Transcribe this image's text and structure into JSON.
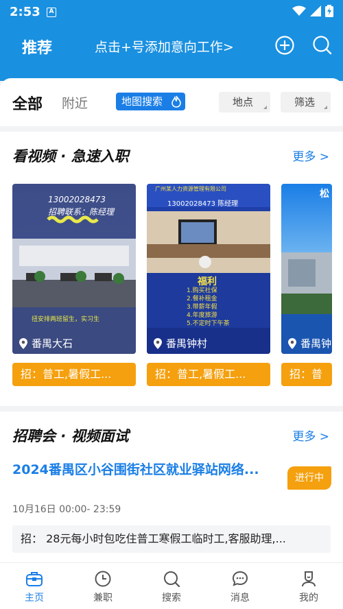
{
  "status": {
    "time": "2:53",
    "a_icon": "A"
  },
  "header": {
    "tab_label": "推荐",
    "add_hint": "点击+号添加意向工作>",
    "plus_icon": "plus-circle-icon",
    "search_icon": "search-icon"
  },
  "filters": {
    "tab_all": "全部",
    "tab_nearby": "附近",
    "map_search": "地图搜索",
    "location": "地点",
    "filter": "筛选"
  },
  "video_section": {
    "title": "看视频 · 急速入职",
    "more": "更多 >",
    "cards": [
      {
        "location": "番禺大石",
        "tag": "招：普工,暑假工...",
        "thumb_phone": "13002028473",
        "thumb_contact": "招聘联系：陈经理",
        "thumb_slogan": "扭安排两班留生，实习生"
      },
      {
        "location": "番禺钟村",
        "tag": "招：普工,暑假工...",
        "thumb_company": "广州某人力资源管理有限公司",
        "thumb_phone": "13002028473",
        "thumb_contact": "陈经理",
        "thumb_welfare": "福利",
        "thumb_items": [
          "1.购买社保",
          "2.餐补租金",
          "3.带薪年假",
          "4.年度旅游",
          "5.不定时下午茶"
        ]
      },
      {
        "location": "番禺钟",
        "tag": "招：普",
        "thumb_title": "松"
      }
    ]
  },
  "fair_section": {
    "title": "招聘会 · 视频面试",
    "more": "更多 >",
    "event_title": "2024番禺区小谷围街社区就业驿站网络...",
    "badge": "进行中",
    "time": "10月16日 00:00- 23:59",
    "recruit": "招：  28元每小时包吃住普工寒假工临时工,客服助理,..."
  },
  "nav": [
    {
      "label": "主页",
      "icon": "briefcase-icon"
    },
    {
      "label": "兼职",
      "icon": "clock-icon"
    },
    {
      "label": "搜索",
      "icon": "search-icon"
    },
    {
      "label": "消息",
      "icon": "message-icon"
    },
    {
      "label": "我的",
      "icon": "user-icon"
    }
  ],
  "colors": {
    "primary": "#1a90e0",
    "accent": "#1a7ee6",
    "orange": "#f5a00e"
  }
}
